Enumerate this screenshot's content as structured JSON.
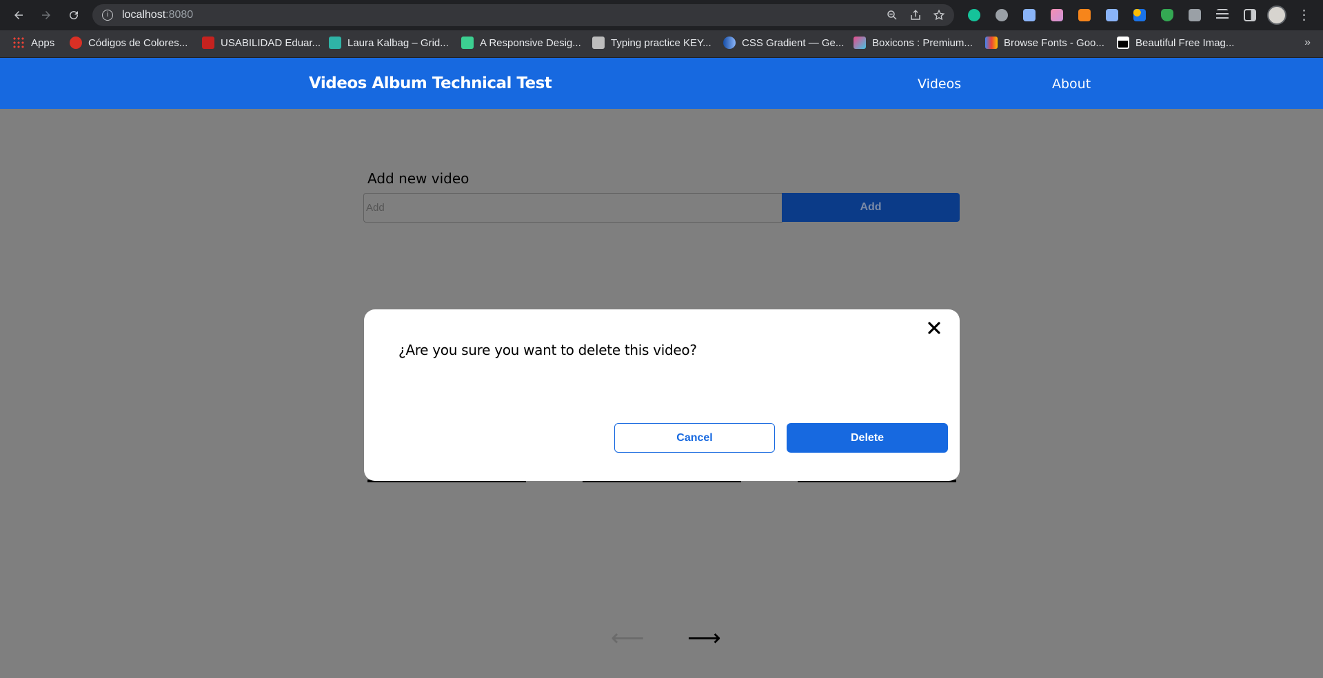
{
  "browser": {
    "url_host": "localhost",
    "url_port": ":8080",
    "bookmarks": [
      {
        "label": "Apps",
        "icon": "apps-grid-icon",
        "color": "#ea4335"
      },
      {
        "label": "Códigos de Colores...",
        "icon": "colors-site-icon",
        "color": "#d93025"
      },
      {
        "label": "USABILIDAD Eduar...",
        "icon": "usabilidad-icon",
        "color": "#c5221f"
      },
      {
        "label": "Laura Kalbag – Grid...",
        "icon": "lk-icon",
        "color": "#2fb3a6"
      },
      {
        "label": "A Responsive Desig...",
        "icon": "responsive-icon",
        "color": "#3ccf91"
      },
      {
        "label": "Typing practice KEY...",
        "icon": "typing-icon",
        "color": "#bdbdbd"
      },
      {
        "label": "CSS Gradient — Ge...",
        "icon": "css-gradient-icon",
        "color": "#1a73e8"
      },
      {
        "label": "Boxicons : Premium...",
        "icon": "boxicons-icon",
        "color": "#e94b8a"
      },
      {
        "label": "Browse Fonts - Goo...",
        "icon": "google-fonts-icon",
        "color": "#f4b400"
      },
      {
        "label": "Beautiful Free Imag...",
        "icon": "unsplash-icon",
        "color": "#000000"
      }
    ],
    "more": "»"
  },
  "header": {
    "title": "Videos Album Technical Test",
    "nav": [
      "Videos",
      "About"
    ],
    "color": "#1769e0"
  },
  "add_form": {
    "title": "Add new video",
    "placeholder": "Add",
    "button_label": "Add"
  },
  "pagination": {
    "prev": "⟵",
    "next": "⟶"
  },
  "modal": {
    "message": "¿Are you sure you want to delete this video?",
    "cancel_label": "Cancel",
    "delete_label": "Delete"
  }
}
